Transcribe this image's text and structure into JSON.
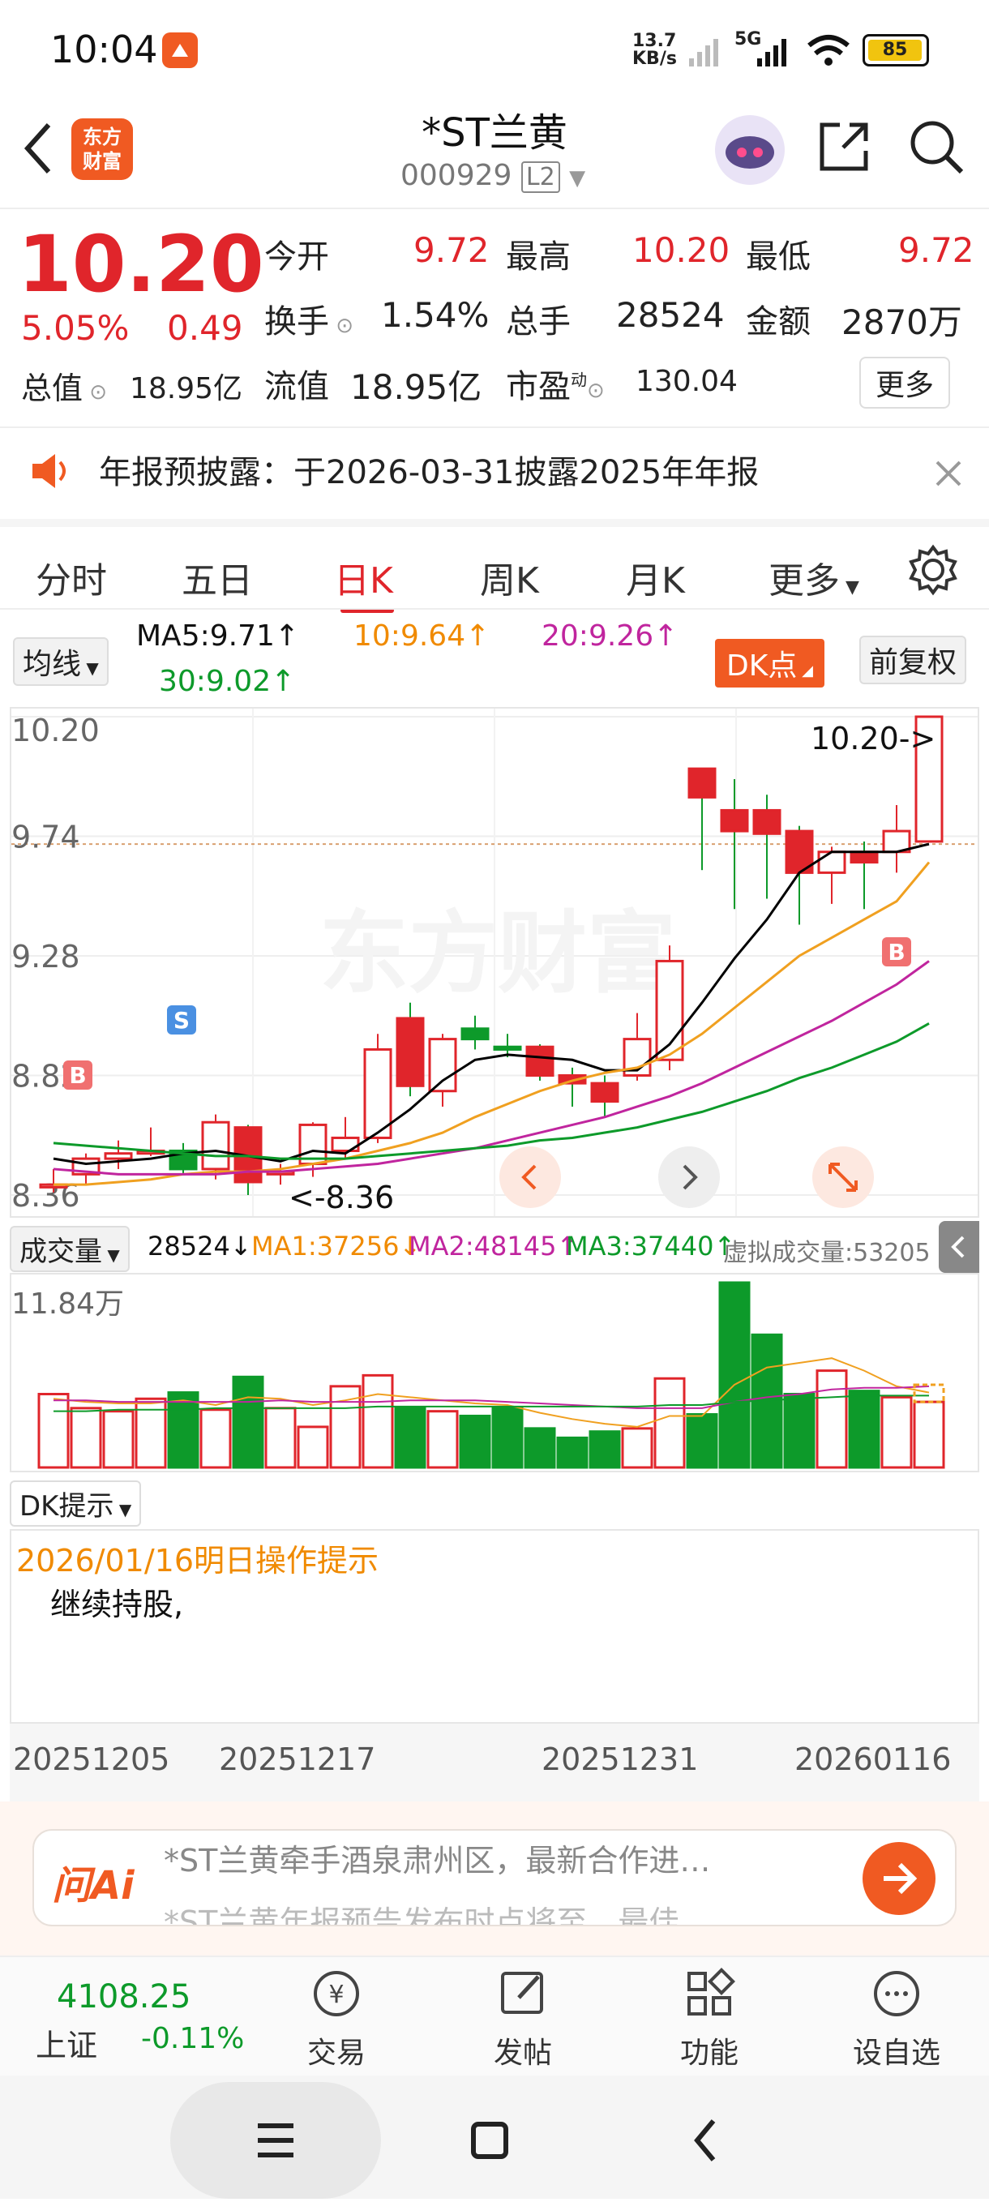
{
  "status_bar": {
    "time": "10:04",
    "net_speed_top": "13.7",
    "net_speed_unit": "KB/s",
    "signal": "5G",
    "battery": "85"
  },
  "header": {
    "logo_line1": "东方",
    "logo_line2": "财富",
    "stock_name": "*ST兰黄",
    "stock_code": "000929",
    "level_badge": "L2"
  },
  "quote": {
    "price": "10.20",
    "change_pct": "5.05%",
    "change_abs": "0.49",
    "open_label": "今开",
    "open": "9.72",
    "high_label": "最高",
    "high": "10.20",
    "low_label": "最低",
    "low": "9.72",
    "turnover_label": "换手",
    "turnover": "1.54%",
    "volume_label": "总手",
    "volume": "28524",
    "amount_label": "金额",
    "amount": "2870万",
    "mktcap_label": "总值",
    "mktcap": "18.95亿",
    "float_label": "流值",
    "float_cap": "18.95亿",
    "pe_label": "市盈",
    "pe_sup": "动",
    "pe": "130.04",
    "more": "更多"
  },
  "notice": {
    "text": "年报预披露：于2026-03-31披露2025年年报"
  },
  "tabs": [
    "分时",
    "五日",
    "日K",
    "周K",
    "月K",
    "更多"
  ],
  "active_tab": "日K",
  "ma_row": {
    "selector": "均线",
    "ma5": "MA5:9.71",
    "ma10": "10:9.64",
    "ma20": "20:9.26",
    "ma30": "30:9.02",
    "dk_button": "DK点",
    "adjust": "前复权"
  },
  "kchart": {
    "y_labels": [
      "10.20",
      "9.74",
      "9.28",
      "8.82",
      "8.36"
    ],
    "max_label": "10.20->",
    "min_label": "<-8.36",
    "watermark": "东方财富",
    "signals": [
      "S",
      "B",
      "B"
    ]
  },
  "volume_row": {
    "selector": "成交量",
    "volume": "28524",
    "ma1": "MA1:37256",
    "ma2": "MA2:48145",
    "ma3": "MA3:37440",
    "virtual": "虚拟成交量:53205"
  },
  "vchart": {
    "y_label": "11.84万"
  },
  "dk_panel": {
    "selector": "DK提示",
    "date_title": "2026/01/16明日操作提示",
    "advice": "继续持股,"
  },
  "dates": [
    "20251205",
    "20251217",
    "20251231",
    "20260116"
  ],
  "ai_bar": {
    "logo": "问Ai",
    "line1": "*ST兰黄牵手酒泉肃州区，最新合作进…",
    "line2": "*ST兰黄年报预告发布时点将至，最佳"
  },
  "bottom_nav": {
    "index_value": "4108.25",
    "index_name": "上证",
    "index_change": "-0.11%",
    "trade": "交易",
    "post": "发帖",
    "func": "功能",
    "watch": "设自选"
  },
  "colors": {
    "up": "#e0252b",
    "down": "#0d9a2a",
    "ma5": "#000000",
    "ma10": "#f0a020",
    "ma20": "#c0259e",
    "ma30": "#0d9a2a",
    "brand": "#f05a22"
  },
  "chart_data": {
    "type": "candlestick",
    "title": "",
    "candles": [
      {
        "open": 8.39,
        "close": 8.4,
        "high": 8.46,
        "low": 8.37
      },
      {
        "open": 8.44,
        "close": 8.5,
        "high": 8.52,
        "low": 8.4
      },
      {
        "open": 8.5,
        "close": 8.52,
        "high": 8.57,
        "low": 8.46
      },
      {
        "open": 8.52,
        "close": 8.53,
        "high": 8.62,
        "low": 8.51
      },
      {
        "open": 8.53,
        "close": 8.46,
        "high": 8.56,
        "low": 8.44
      },
      {
        "open": 8.46,
        "close": 8.64,
        "high": 8.67,
        "low": 8.42
      },
      {
        "open": 8.62,
        "close": 8.41,
        "high": 8.63,
        "low": 8.36
      },
      {
        "open": 8.44,
        "close": 8.45,
        "high": 8.48,
        "low": 8.4
      },
      {
        "open": 8.48,
        "close": 8.63,
        "high": 8.64,
        "low": 8.43
      },
      {
        "open": 8.53,
        "close": 8.58,
        "high": 8.66,
        "low": 8.5
      },
      {
        "open": 8.58,
        "close": 8.92,
        "high": 8.98,
        "low": 8.56
      },
      {
        "open": 9.04,
        "close": 8.78,
        "high": 9.1,
        "low": 8.74
      },
      {
        "open": 8.76,
        "close": 8.96,
        "high": 8.98,
        "low": 8.7
      },
      {
        "open": 9.0,
        "close": 8.96,
        "high": 9.05,
        "low": 8.92
      },
      {
        "open": 8.93,
        "close": 8.92,
        "high": 8.98,
        "low": 8.89
      },
      {
        "open": 8.93,
        "close": 8.82,
        "high": 8.94,
        "low": 8.8
      },
      {
        "open": 8.82,
        "close": 8.79,
        "high": 8.85,
        "low": 8.7
      },
      {
        "open": 8.79,
        "close": 8.72,
        "high": 8.82,
        "low": 8.66
      },
      {
        "open": 8.82,
        "close": 8.96,
        "high": 9.06,
        "low": 8.8
      },
      {
        "open": 8.88,
        "close": 9.26,
        "high": 9.32,
        "low": 8.84
      },
      {
        "open": 10.0,
        "close": 9.89,
        "high": 10.0,
        "low": 9.61
      },
      {
        "open": 9.84,
        "close": 9.76,
        "high": 9.96,
        "low": 9.46
      },
      {
        "open": 9.84,
        "close": 9.75,
        "high": 9.9,
        "low": 9.5
      },
      {
        "open": 9.76,
        "close": 9.6,
        "high": 9.78,
        "low": 9.4
      },
      {
        "open": 9.6,
        "close": 9.68,
        "high": 9.7,
        "low": 9.48
      },
      {
        "open": 9.68,
        "close": 9.64,
        "high": 9.72,
        "low": 9.46
      },
      {
        "open": 9.68,
        "close": 9.76,
        "high": 9.86,
        "low": 9.6
      },
      {
        "open": 9.72,
        "close": 10.2,
        "high": 10.2,
        "low": 9.72
      }
    ],
    "ma5": [
      8.5,
      8.48,
      8.49,
      8.5,
      8.52,
      8.53,
      8.51,
      8.49,
      8.53,
      8.52,
      8.6,
      8.69,
      8.8,
      8.88,
      8.9,
      8.89,
      8.88,
      8.84,
      8.84,
      8.94,
      9.1,
      9.27,
      9.42,
      9.6,
      9.68,
      9.68,
      9.68,
      9.71
    ],
    "ma10": [
      8.4,
      8.4,
      8.41,
      8.42,
      8.44,
      8.45,
      8.45,
      8.46,
      8.48,
      8.5,
      8.53,
      8.56,
      8.6,
      8.66,
      8.71,
      8.76,
      8.8,
      8.83,
      8.85,
      8.9,
      8.98,
      9.08,
      9.18,
      9.28,
      9.35,
      9.42,
      9.49,
      9.64
    ],
    "ma20": [
      8.46,
      8.45,
      8.44,
      8.44,
      8.44,
      8.44,
      8.45,
      8.45,
      8.46,
      8.47,
      8.48,
      8.5,
      8.52,
      8.54,
      8.57,
      8.6,
      8.63,
      8.66,
      8.7,
      8.74,
      8.79,
      8.85,
      8.91,
      8.97,
      9.03,
      9.1,
      9.17,
      9.26
    ],
    "ma30": [
      8.56,
      8.55,
      8.54,
      8.53,
      8.52,
      8.51,
      8.51,
      8.5,
      8.5,
      8.5,
      8.51,
      8.52,
      8.53,
      8.54,
      8.55,
      8.57,
      8.58,
      8.6,
      8.62,
      8.65,
      8.68,
      8.72,
      8.76,
      8.81,
      8.85,
      8.9,
      8.95,
      9.02
    ],
    "y_range": [
      8.36,
      10.2
    ],
    "volume": [
      4.7,
      3.8,
      3.6,
      4.4,
      4.8,
      3.7,
      5.8,
      3.8,
      2.6,
      5.2,
      5.9,
      3.8,
      3.6,
      3.3,
      3.8,
      2.5,
      1.9,
      2.3,
      2.5,
      5.7,
      3.4,
      11.84,
      8.5,
      4.7,
      6.2,
      4.9,
      4.5,
      4.2
    ],
    "volume_ylim": [
      0,
      11.84
    ]
  }
}
